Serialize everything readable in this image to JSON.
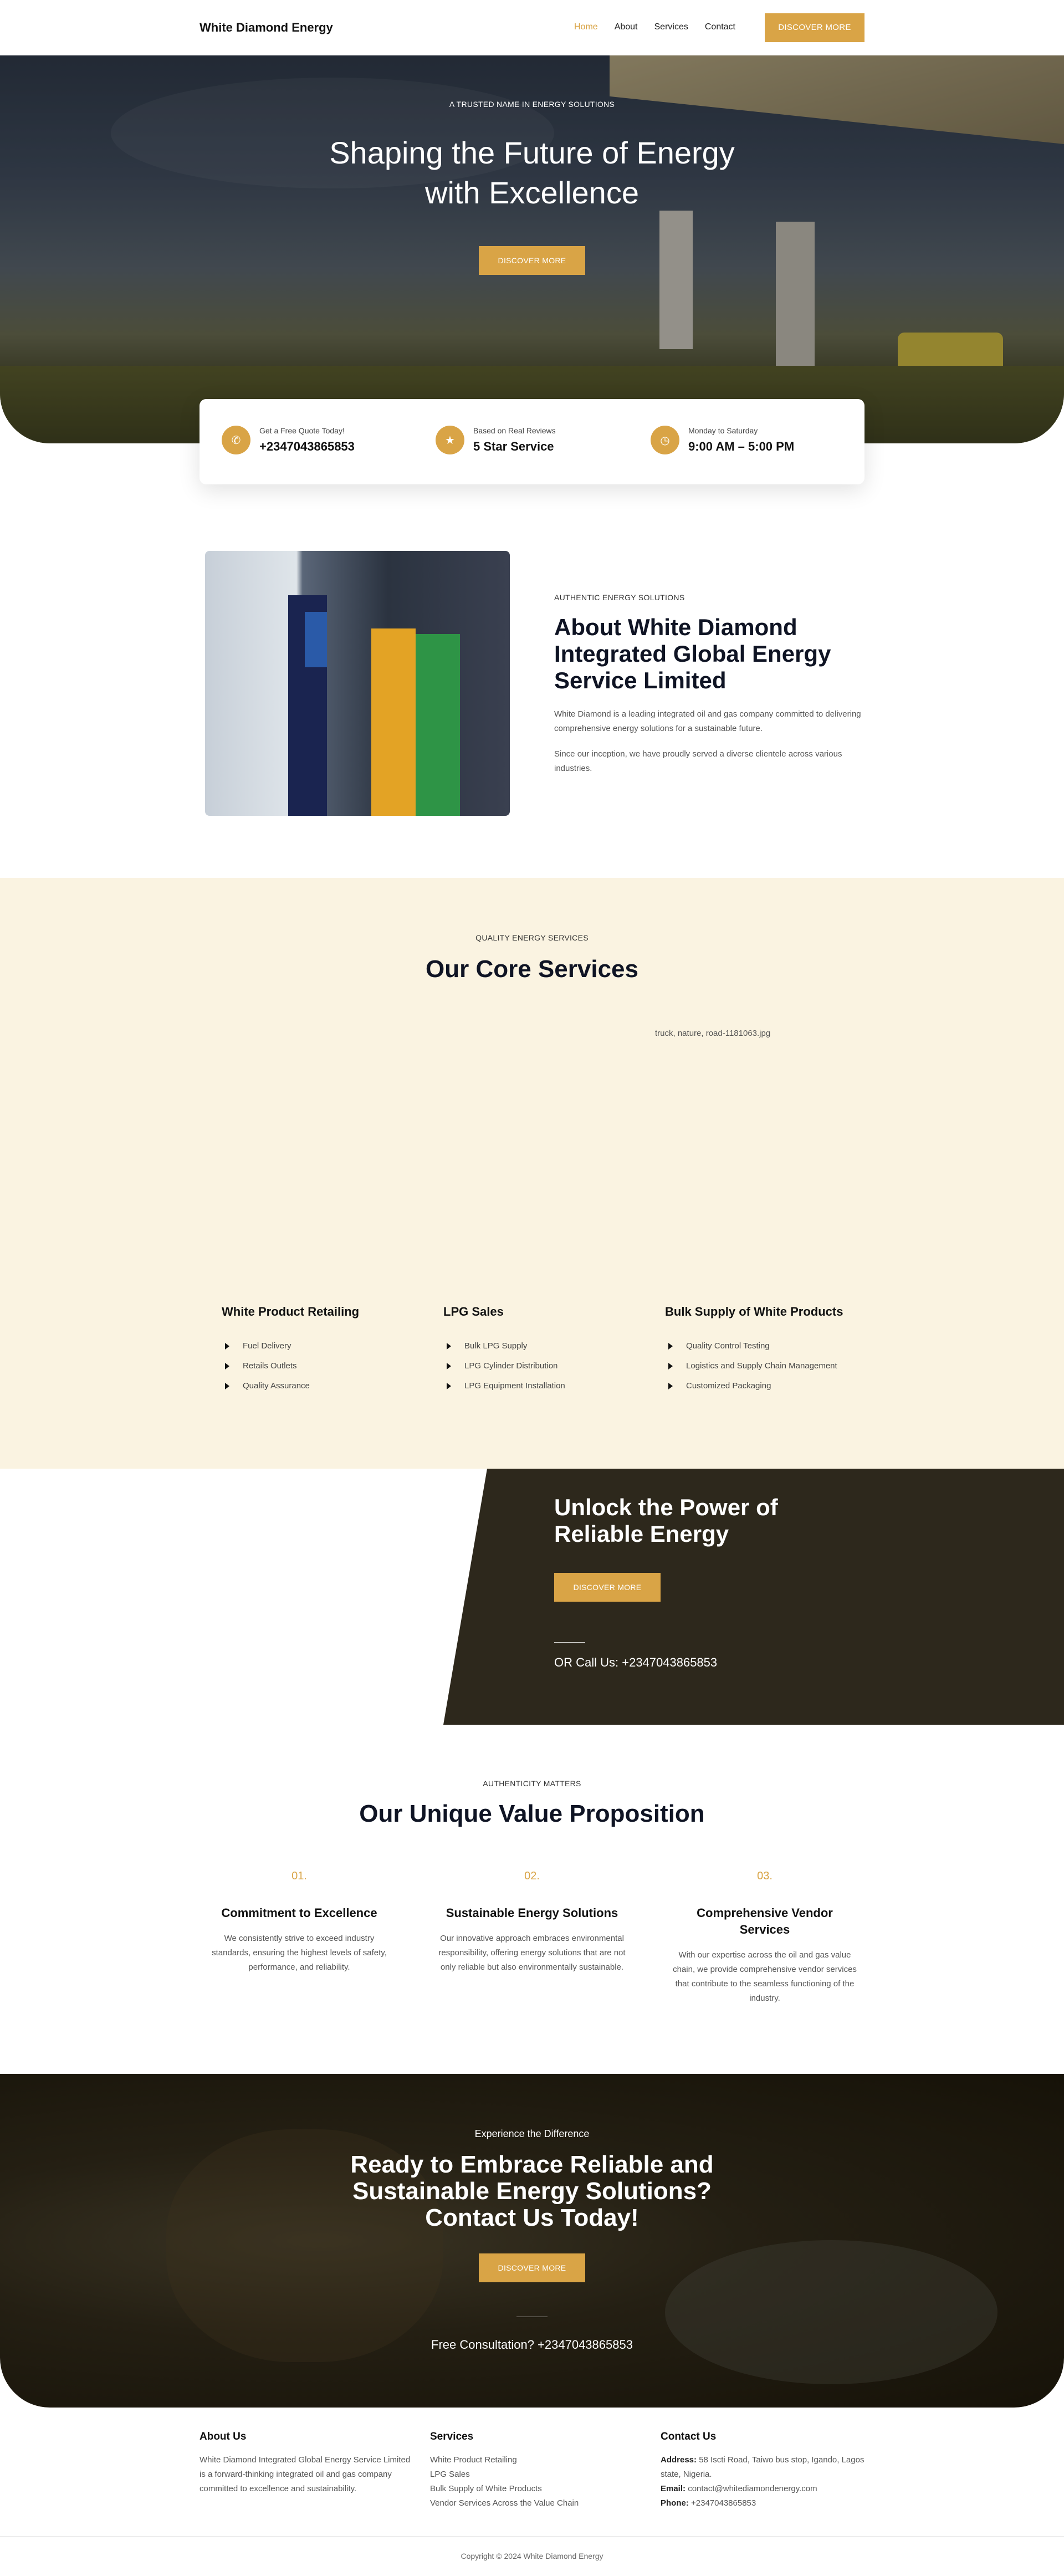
{
  "header": {
    "brand": "White Diamond Energy",
    "nav": [
      "Home",
      "About",
      "Services",
      "Contact"
    ],
    "cta": "DISCOVER MORE"
  },
  "hero": {
    "eyebrow": "A TRUSTED NAME IN ENERGY SOLUTIONS",
    "title": "Shaping the Future of Energy with Excellence",
    "button": "DISCOVER MORE"
  },
  "info": [
    {
      "icon": "phone-icon",
      "small": "Get a Free Quote Today!",
      "big": "+2347043865853"
    },
    {
      "icon": "star-icon",
      "small": "Based on Real Reviews",
      "big": "5 Star Service"
    },
    {
      "icon": "clock-icon",
      "small": "Monday to Saturday",
      "big": "9:00 AM – 5:00 PM"
    }
  ],
  "about": {
    "eyebrow": "AUTHENTIC ENERGY SOLUTIONS",
    "title": "About White Diamond Integrated Global Energy Service Limited",
    "p1": "White Diamond is a leading integrated oil and gas company committed to delivering comprehensive energy solutions for a sustainable future.",
    "p2": "Since our inception, we have proudly served a diverse clientele across various industries."
  },
  "services": {
    "eyebrow": "QUALITY ENERGY SERVICES",
    "title": "Our Core Services",
    "image_name": "truck, nature, road-1181063.jpg",
    "columns": [
      {
        "title": "White Product Retailing",
        "items": [
          "Fuel Delivery",
          "Retails Outlets",
          "Quality Assurance"
        ]
      },
      {
        "title": "LPG Sales",
        "items": [
          "Bulk LPG Supply",
          "LPG Cylinder Distribution",
          "LPG Equipment Installation"
        ]
      },
      {
        "title": "Bulk Supply of White Products",
        "items": [
          "Quality Control Testing",
          "Logistics and Supply Chain Management",
          "Customized Packaging"
        ]
      }
    ]
  },
  "unlock": {
    "title": "Unlock the Power of Reliable Energy",
    "button": "DISCOVER MORE",
    "call": "OR Call Us: +2347043865853"
  },
  "value": {
    "eyebrow": "AUTHENTICITY MATTERS",
    "title": "Our Unique Value Proposition",
    "items": [
      {
        "num": "01.",
        "title": "Commitment to Excellence",
        "text": "We consistently strive to exceed industry standards, ensuring the highest levels of safety, performance, and reliability."
      },
      {
        "num": "02.",
        "title": "Sustainable Energy Solutions",
        "text": "Our innovative approach embraces environmental responsibility, offering energy solutions that are not only reliable but also environmentally sustainable."
      },
      {
        "num": "03.",
        "title": "Comprehensive Vendor Services",
        "text": "With our expertise across the oil and gas value chain, we provide comprehensive vendor services that contribute to the seamless functioning of the industry."
      }
    ]
  },
  "cta": {
    "eyebrow": "Experience the Difference",
    "title": "Ready to Embrace Reliable and Sustainable Energy Solutions? Contact Us Today!",
    "button": "DISCOVER MORE",
    "call": "Free Consultation? +2347043865853"
  },
  "footer": {
    "about": {
      "title": "About Us",
      "text": "White Diamond Integrated Global Energy Service Limited is a forward-thinking integrated oil and gas company committed to excellence and sustainability."
    },
    "services": {
      "title": "Services",
      "items": [
        "White Product Retailing",
        "LPG Sales",
        "Bulk Supply of White Products",
        "Vendor Services Across the Value Chain"
      ]
    },
    "contact": {
      "title": "Contact Us",
      "address_label": "Address:",
      "address": "58 Iscti Road, Taiwo bus stop, Igando, Lagos state, Nigeria.",
      "email_label": "Email:",
      "email": "contact@whitediamondenergy.com",
      "phone_label": "Phone:",
      "phone": "+2347043865853"
    },
    "copyright": "Copyright © 2024 White Diamond Energy"
  },
  "colors": {
    "accent": "#d9a446",
    "dark": "#2d281c",
    "cream": "#faf3e1"
  }
}
